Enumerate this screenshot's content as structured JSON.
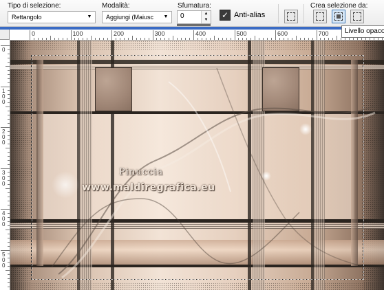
{
  "toolbar": {
    "selection_type": {
      "label": "Tipo di selezione:",
      "value": "Rettangolo"
    },
    "mode": {
      "label": "Modalità:",
      "value": "Aggiungi (Maiusc"
    },
    "feather": {
      "label": "Sfumatura:",
      "value": "0"
    },
    "antialias": {
      "label": "Anti-alias",
      "checked": true
    },
    "create_from": {
      "label": "Crea selezione da:",
      "buttons": [
        "selection-from-layer-icon",
        "selection-from-opaque-icon",
        "selection-from-mask-icon"
      ]
    },
    "tooltip": "Livello opaco"
  },
  "colors": {
    "accent": "#3a6bc4",
    "selection_border": "#111111"
  },
  "ruler": {
    "horizontal_labels": [
      "0",
      "100",
      "200",
      "300",
      "400",
      "500",
      "600",
      "700"
    ],
    "vertical_labels": [
      "0",
      "100",
      "200",
      "300",
      "400",
      "500"
    ]
  },
  "canvas": {
    "watermark_line1": "Pinuccia",
    "watermark_line2": "www.maldiregrafica.eu"
  }
}
